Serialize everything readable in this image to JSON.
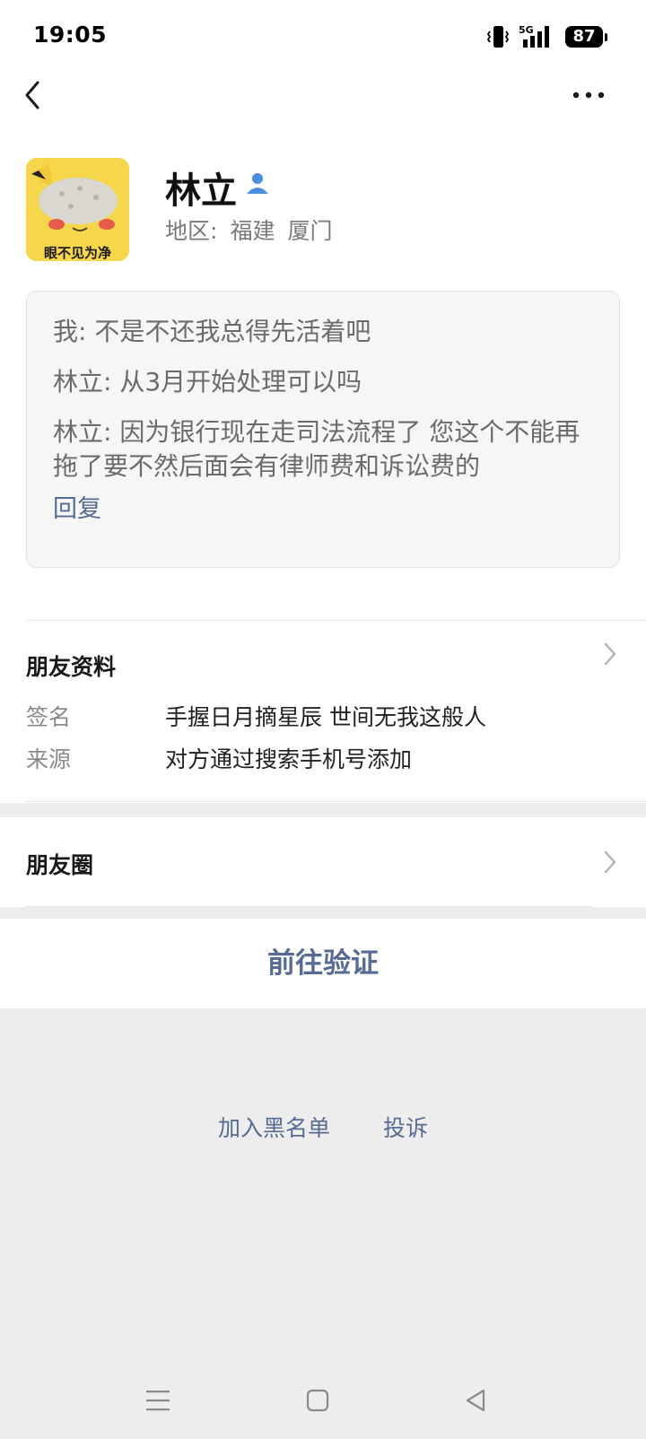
{
  "status_bar": {
    "time": "19:05",
    "network": "5G",
    "battery": "87"
  },
  "nav": {
    "back_icon": "chevron-left-icon",
    "more_icon": "more-dots-icon"
  },
  "profile": {
    "avatar_caption": "眼不见为净",
    "name": "林立",
    "region_label": "地区:",
    "region_province": "福建",
    "region_city": "厦门"
  },
  "messages": {
    "items": [
      "我: 不是不还我总得先活着吧",
      "林立: 从3月开始处理可以吗",
      "林立: 因为银行现在走司法流程了 您这个不能再拖了要不然后面会有律师费和诉讼费的"
    ],
    "reply_label": "回复"
  },
  "friend_info": {
    "title": "朋友资料",
    "signature_label": "签名",
    "signature_value": "手握日月摘星辰 世间无我这般人",
    "source_label": "来源",
    "source_value": "对方通过搜索手机号添加"
  },
  "moments": {
    "title": "朋友圈"
  },
  "actions": {
    "verify_label": "前往验证",
    "blacklist_label": "加入黑名单",
    "report_label": "投诉"
  },
  "colors": {
    "link": "#576b95",
    "background": "#ededed",
    "card": "#f6f6f6"
  }
}
